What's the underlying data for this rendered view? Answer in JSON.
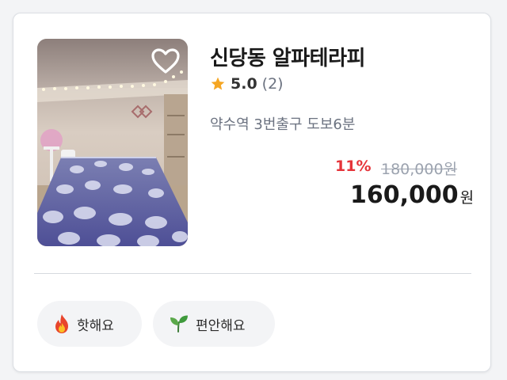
{
  "card": {
    "title": "신당동 알파테라피",
    "rating": {
      "score": "5.0",
      "count": "(2)",
      "icon": "star-icon",
      "star_color": "#f5a623"
    },
    "location": "약수역 3번출구 도보6분",
    "price": {
      "discount": "11%",
      "original": "180,000원",
      "current": "160,000",
      "unit": "원",
      "discount_color": "#e5343a"
    },
    "favorite_icon": "heart-outline-icon",
    "tags": [
      {
        "label": "핫해요",
        "icon": "fire-icon"
      },
      {
        "label": "편안해요",
        "icon": "leaf-icon"
      }
    ]
  }
}
